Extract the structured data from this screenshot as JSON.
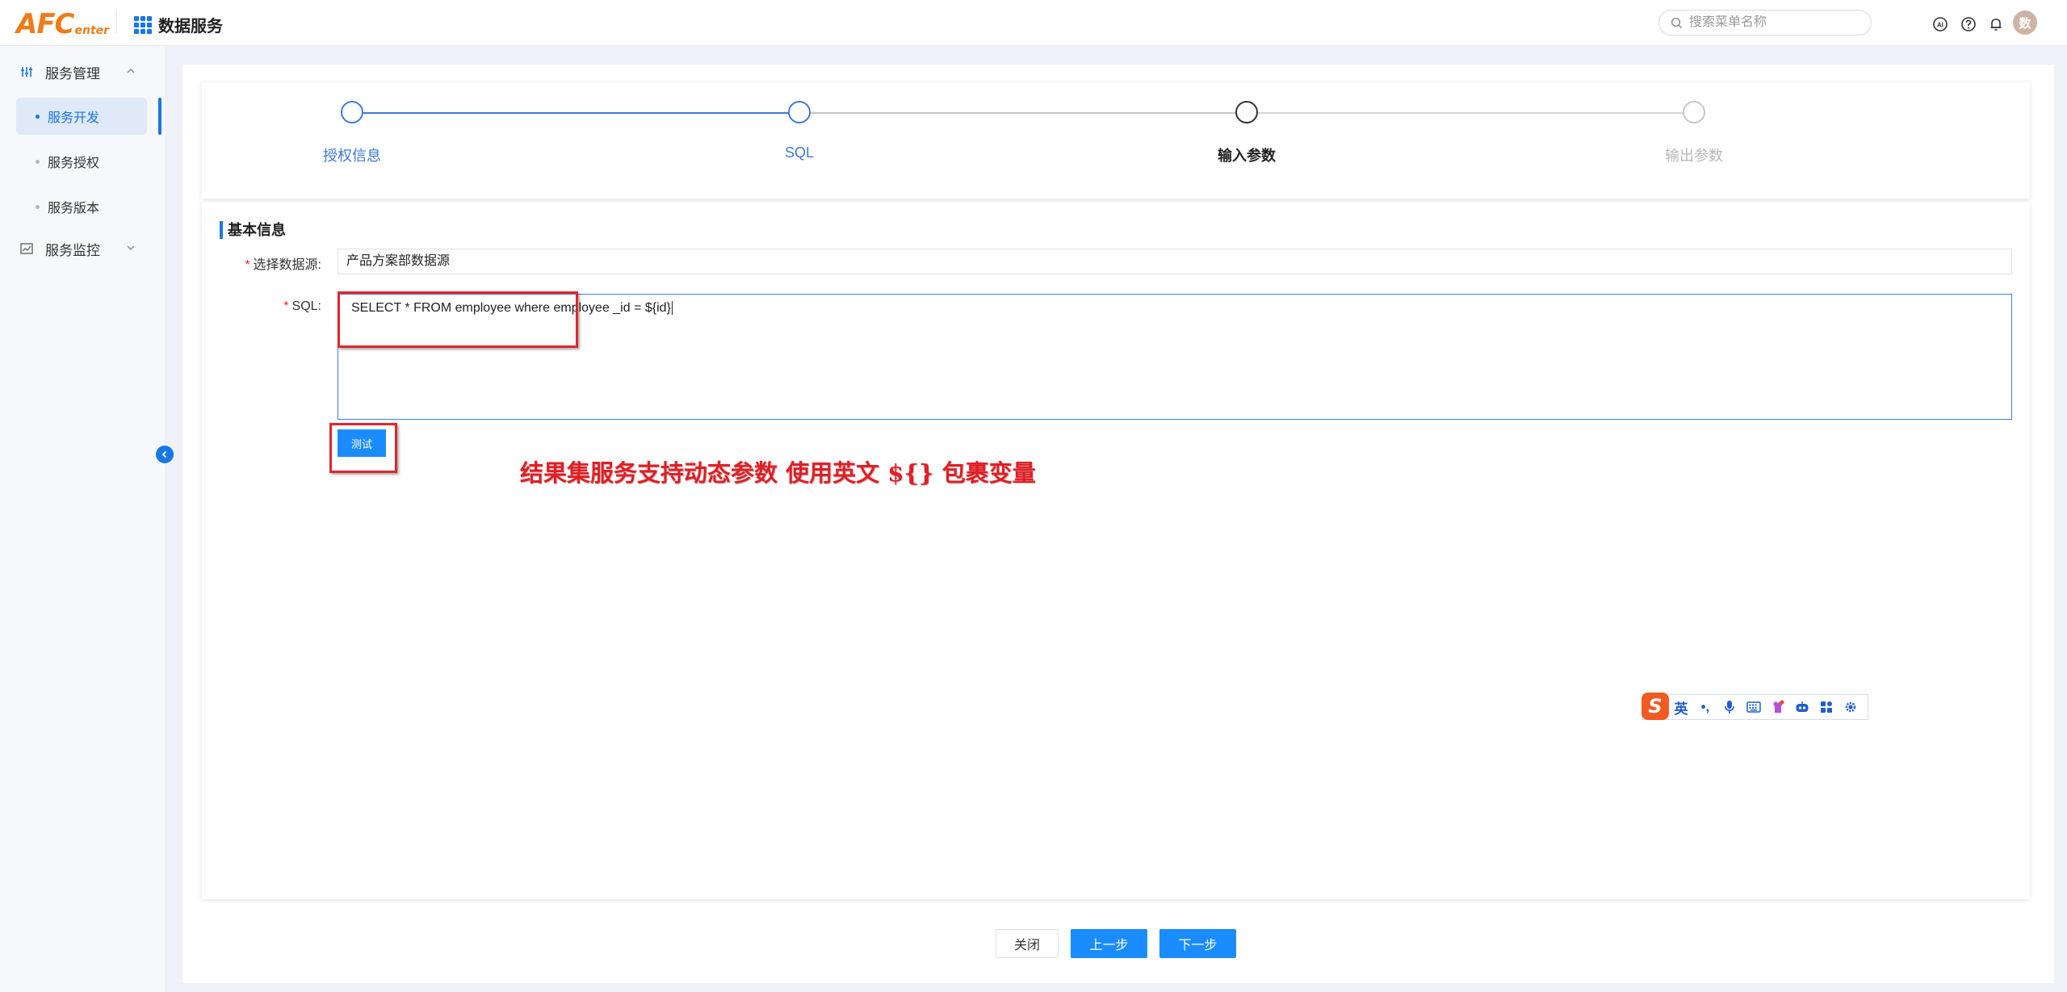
{
  "header": {
    "logo_main": "AFC",
    "logo_sub": "enter",
    "app_title": "数据服务",
    "search_placeholder": "搜索菜单名称",
    "avatar_text": "数"
  },
  "sidebar": {
    "groups": [
      {
        "label": "服务管理",
        "expanded": true,
        "items": [
          {
            "label": "服务开发",
            "active": true
          },
          {
            "label": "服务授权",
            "active": false
          },
          {
            "label": "服务版本",
            "active": false
          }
        ]
      },
      {
        "label": "服务监控",
        "expanded": false
      }
    ]
  },
  "steps": [
    {
      "label": "授权信息",
      "state": "done"
    },
    {
      "label": "SQL",
      "state": "done"
    },
    {
      "label": "输入参数",
      "state": "current"
    },
    {
      "label": "输出参数",
      "state": "pending"
    }
  ],
  "form": {
    "section_title": "基本信息",
    "datasource_label": "选择数据源:",
    "datasource_value": "产品方案部数据源",
    "sql_label": "SQL:",
    "sql_value": "SELECT * FROM employee where employee _id = ${id}",
    "test_button": "测试",
    "required_mark": "*"
  },
  "annotation": "结果集服务支持动态参数 使用英文 ${} 包裹变量",
  "footer": {
    "close": "关闭",
    "prev": "上一步",
    "next": "下一步"
  },
  "ime": {
    "mode_label": "英",
    "punct_label": "•,"
  },
  "colors": {
    "primary": "#1677e6",
    "button": "#1a8cff",
    "annotation_red": "#e31e24",
    "logo_orange": "#f07b1a"
  }
}
